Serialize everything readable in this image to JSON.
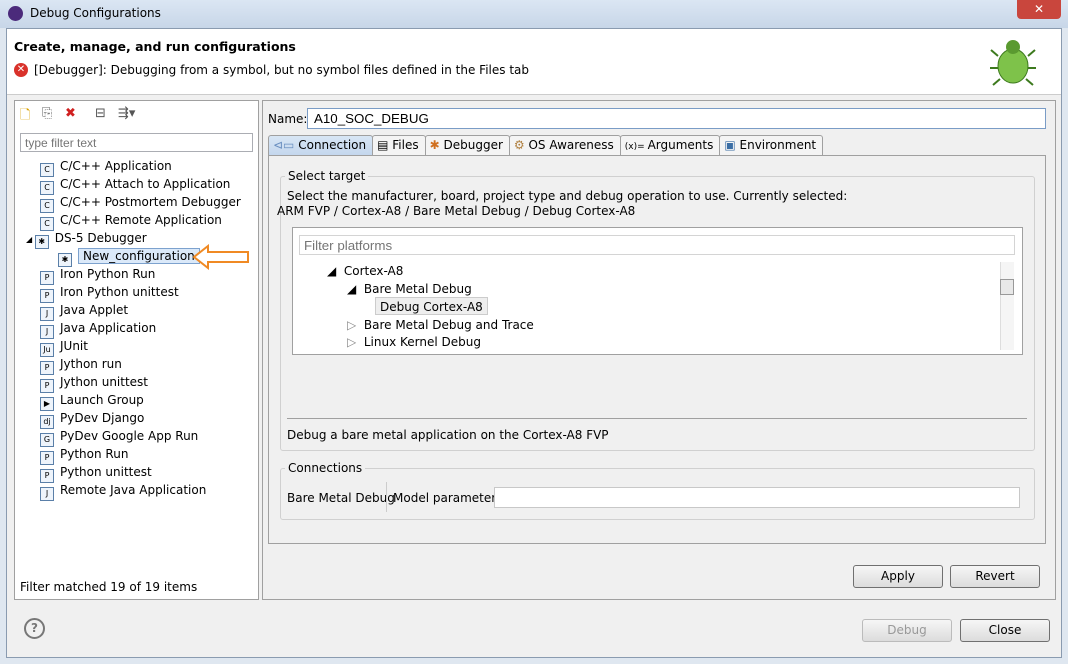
{
  "window": {
    "title": "Debug Configurations",
    "close": "✕"
  },
  "header": {
    "title": "Create, manage, and run configurations",
    "error": "[Debugger]: Debugging from a symbol, but no symbol files defined in the Files tab"
  },
  "left": {
    "filter_placeholder": "type filter text",
    "filter_status": "Filter matched 19 of 19 items",
    "items": [
      {
        "label": "C/C++ Application",
        "icon": "C"
      },
      {
        "label": "C/C++ Attach to Application",
        "icon": "C"
      },
      {
        "label": "C/C++ Postmortem Debugger",
        "icon": "C"
      },
      {
        "label": "C/C++ Remote Application",
        "icon": "C"
      },
      {
        "label": "DS-5 Debugger",
        "icon": "✱"
      },
      {
        "label": "New_configuration",
        "icon": "✱"
      },
      {
        "label": "Iron Python Run",
        "icon": "P"
      },
      {
        "label": "Iron Python unittest",
        "icon": "P"
      },
      {
        "label": "Java Applet",
        "icon": "J"
      },
      {
        "label": "Java Application",
        "icon": "J"
      },
      {
        "label": "JUnit",
        "icon": "Ju"
      },
      {
        "label": "Jython run",
        "icon": "P"
      },
      {
        "label": "Jython unittest",
        "icon": "P"
      },
      {
        "label": "Launch Group",
        "icon": "▶"
      },
      {
        "label": "PyDev Django",
        "icon": "dj"
      },
      {
        "label": "PyDev Google App Run",
        "icon": "G"
      },
      {
        "label": "Python Run",
        "icon": "P"
      },
      {
        "label": "Python unittest",
        "icon": "P"
      },
      {
        "label": "Remote Java Application",
        "icon": "J"
      }
    ]
  },
  "right": {
    "name_label": "Name:",
    "name_value": "A10_SOC_DEBUG",
    "tabs": [
      "Connection",
      "Files",
      "Debugger",
      "OS Awareness",
      "Arguments",
      "Environment"
    ],
    "select_target": "Select target",
    "instructions": "Select the manufacturer, board, project type and debug operation to use. Currently selected:",
    "current": "ARM FVP / Cortex-A8 / Bare Metal Debug / Debug Cortex-A8",
    "filter_placeholder": "Filter platforms",
    "platforms": [
      "Cortex-A8",
      "Bare Metal Debug",
      "Debug Cortex-A8",
      "Bare Metal Debug and Trace",
      "Linux Kernel Debug"
    ],
    "description": "Debug a bare metal application on the Cortex-A8 FVP",
    "connections": "Connections",
    "bare_metal": "Bare Metal Debug",
    "model_params": "Model parameters",
    "apply": "Apply",
    "revert": "Revert"
  },
  "footer": {
    "debug": "Debug",
    "close": "Close",
    "help": "?"
  }
}
